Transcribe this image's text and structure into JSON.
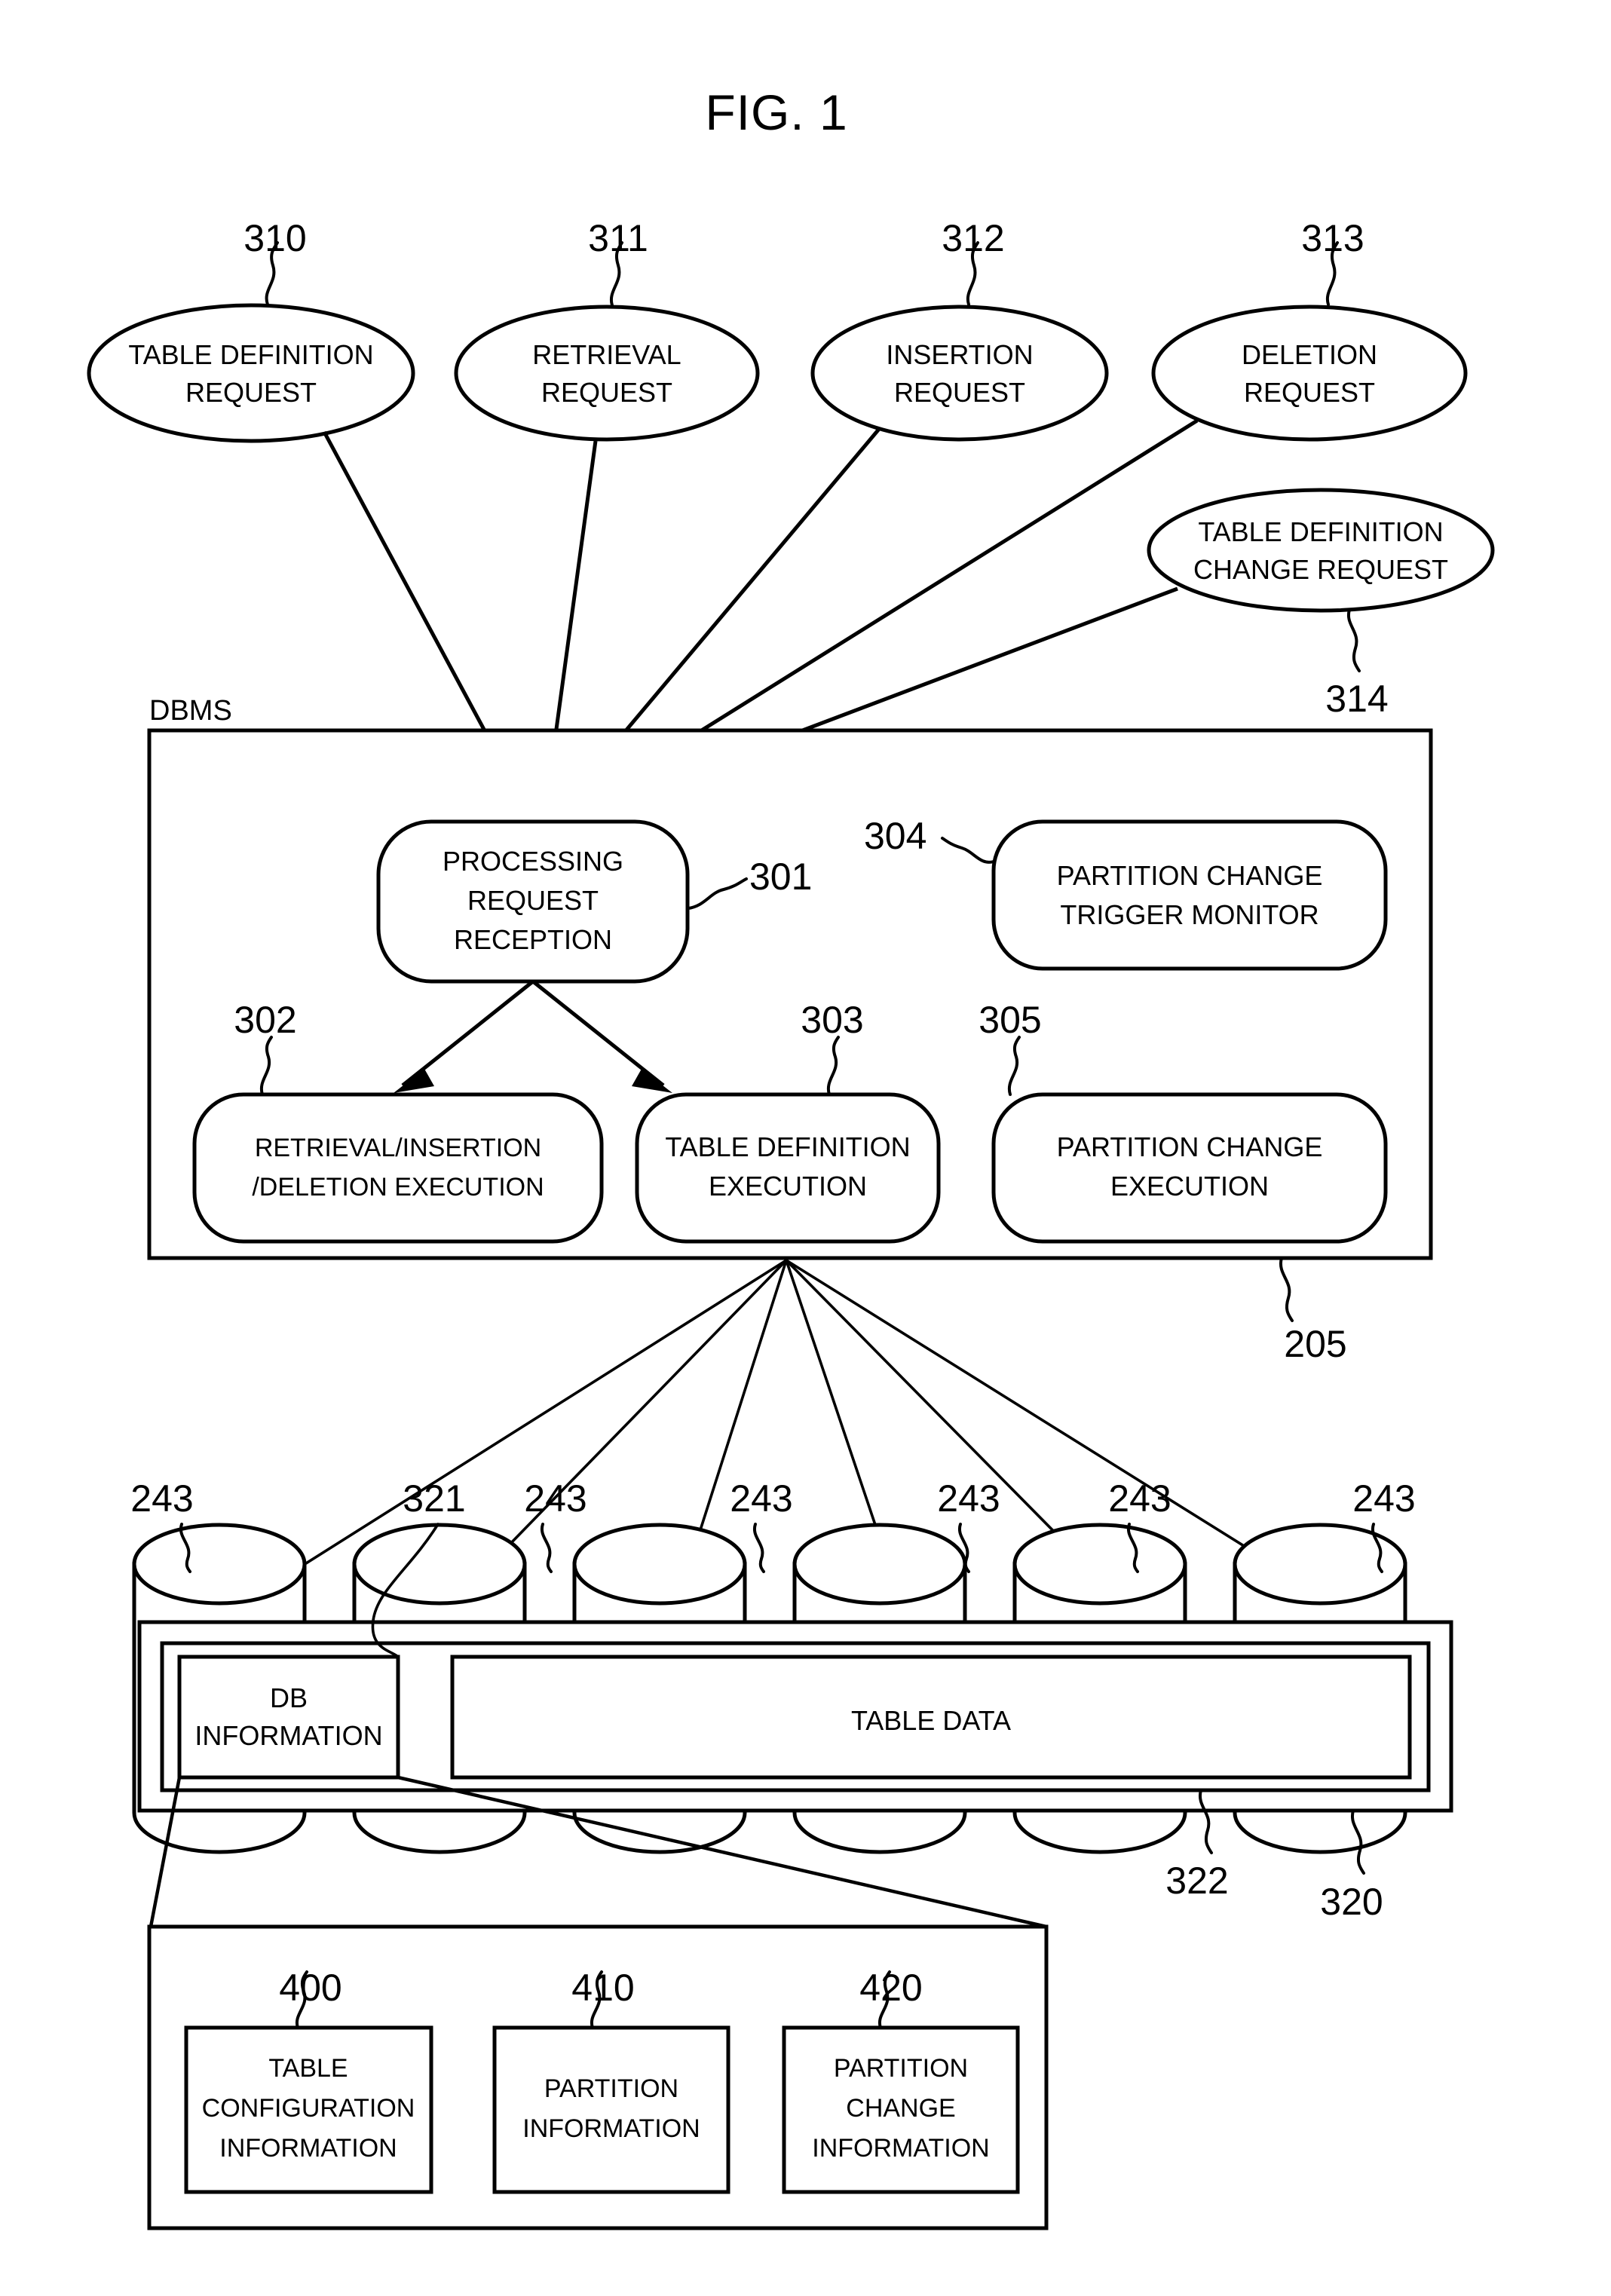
{
  "figure": {
    "title": "FIG. 1",
    "dbms_label": "DBMS"
  },
  "request_nodes": [
    {
      "id": "310",
      "ref": "310",
      "label_line1": "TABLE DEFINITION",
      "label_line2": "REQUEST"
    },
    {
      "id": "311",
      "ref": "311",
      "label_line1": "RETRIEVAL",
      "label_line2": "REQUEST"
    },
    {
      "id": "312",
      "ref": "312",
      "label_line1": "INSERTION",
      "label_line2": "REQUEST"
    },
    {
      "id": "313",
      "ref": "313",
      "label_line1": "DELETION",
      "label_line2": "REQUEST"
    },
    {
      "id": "314",
      "ref": "314",
      "label_line1": "TABLE DEFINITION",
      "label_line2": "CHANGE REQUEST"
    }
  ],
  "dbms": {
    "ref": "205",
    "modules": [
      {
        "ref": "301",
        "label_line1": "PROCESSING",
        "label_line2": "REQUEST",
        "label_line3": "RECEPTION"
      },
      {
        "ref": "304",
        "label_line1": "PARTITION CHANGE",
        "label_line2": "TRIGGER MONITOR"
      },
      {
        "ref": "302",
        "label_line1": "RETRIEVAL/INSERTION",
        "label_line2": "/DELETION EXECUTION"
      },
      {
        "ref": "303",
        "label_line1": "TABLE DEFINITION",
        "label_line2": "EXECUTION"
      },
      {
        "ref": "305",
        "label_line1": "PARTITION CHANGE",
        "label_line2": "EXECUTION"
      }
    ]
  },
  "storage": {
    "disk_refs": [
      "243",
      "321",
      "243",
      "243",
      "243",
      "243",
      "243"
    ],
    "db_information_label_line1": "DB",
    "db_information_label_line2": "INFORMATION",
    "table_data_label": "TABLE DATA",
    "outer_ref": "320",
    "inner_ref": "322"
  },
  "db_information_detail": {
    "items": [
      {
        "ref": "400",
        "label_line1": "TABLE",
        "label_line2": "CONFIGURATION",
        "label_line3": "INFORMATION"
      },
      {
        "ref": "410",
        "label_line1": "PARTITION",
        "label_line2": "INFORMATION",
        "label_line3": ""
      },
      {
        "ref": "420",
        "label_line1": "PARTITION",
        "label_line2": "CHANGE",
        "label_line3": "INFORMATION"
      }
    ]
  }
}
